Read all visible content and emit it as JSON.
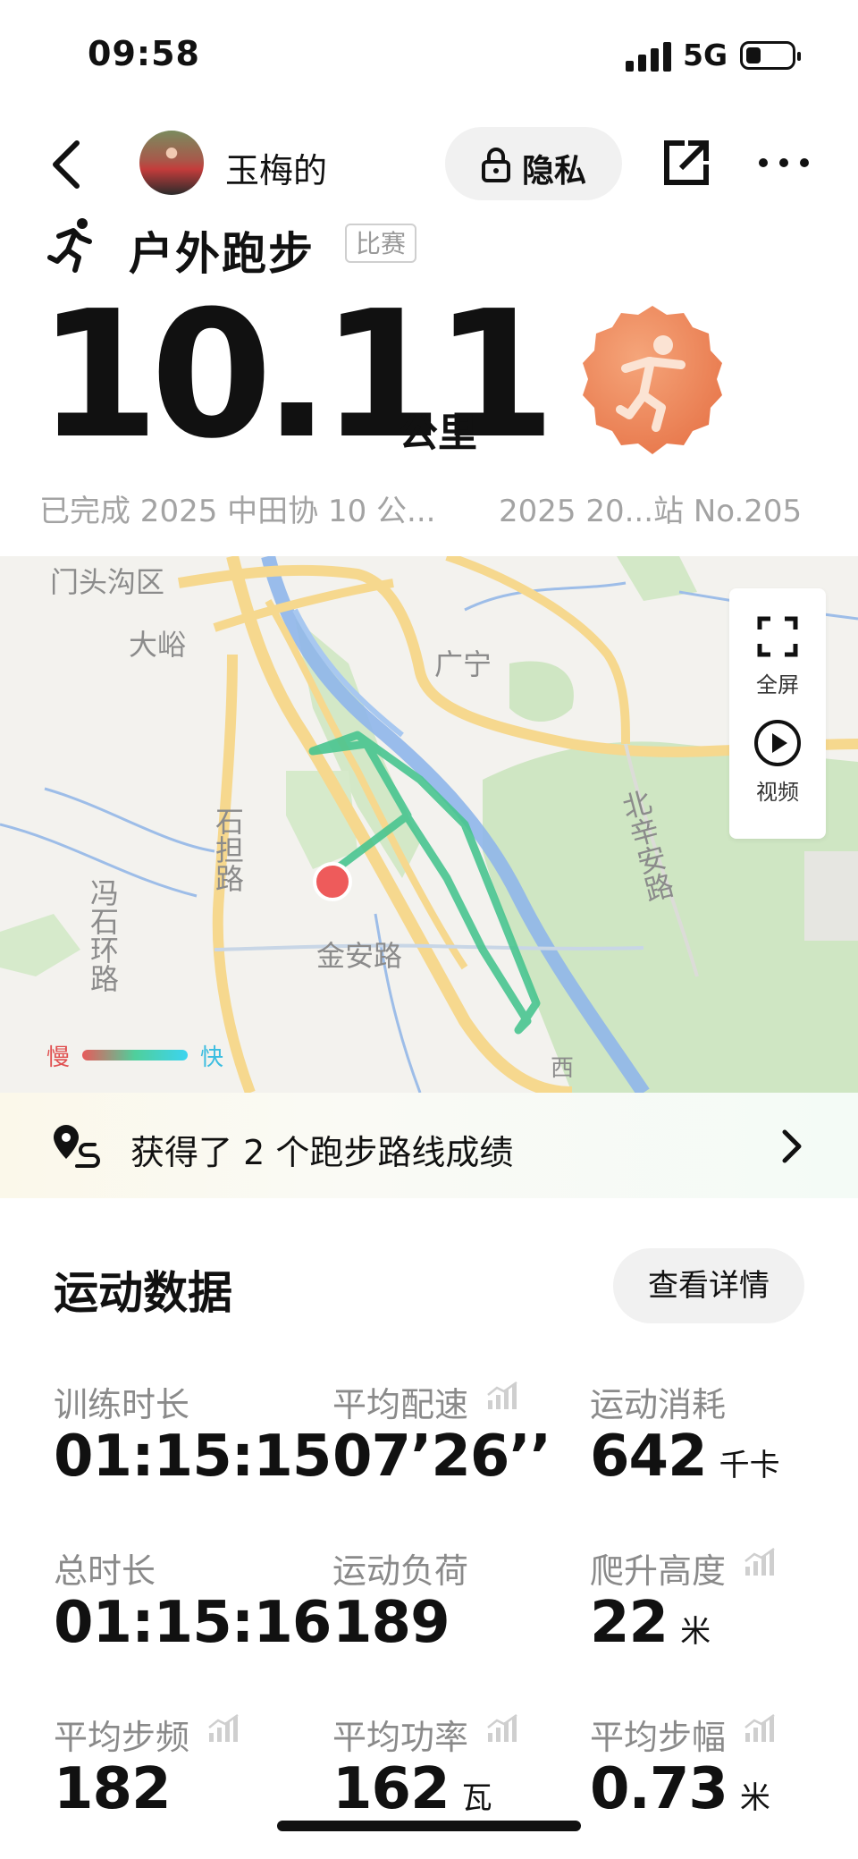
{
  "status_bar": {
    "time": "09:58",
    "network": "5G"
  },
  "header": {
    "user_name": "玉梅的",
    "privacy_label": "隐私"
  },
  "activity": {
    "title": "户外跑步",
    "tag": "比赛",
    "distance": "10.11",
    "distance_unit": "公里",
    "completed_text": "已完成 2025 中田协 10 公...",
    "event_text": "2025 20...站 No.205"
  },
  "map": {
    "labels": [
      "门头沟区",
      "大峪",
      "广宁",
      "石担路",
      "冯石环路",
      "金安路",
      "北辛安路",
      "西"
    ],
    "fullscreen_label": "全屏",
    "video_label": "视频",
    "legend_slow": "慢",
    "legend_fast": "快"
  },
  "achievement": {
    "text": "获得了 2 个跑步路线成绩"
  },
  "sports_data": {
    "title": "运动数据",
    "detail_button": "查看详情",
    "stats": [
      {
        "label": "训练时长",
        "value": "01:15:15",
        "unit": ""
      },
      {
        "label": "平均配速",
        "value": "07’26’’",
        "unit": ""
      },
      {
        "label": "运动消耗",
        "value": "642",
        "unit": "千卡"
      },
      {
        "label": "总时长",
        "value": "01:15:16",
        "unit": ""
      },
      {
        "label": "运动负荷",
        "value": "189",
        "unit": ""
      },
      {
        "label": "爬升高度",
        "value": "22",
        "unit": "米"
      },
      {
        "label": "平均步频",
        "value": "182",
        "unit": ""
      },
      {
        "label": "平均功率",
        "value": "162",
        "unit": "瓦"
      },
      {
        "label": "平均步幅",
        "value": "0.73",
        "unit": "米"
      }
    ]
  }
}
